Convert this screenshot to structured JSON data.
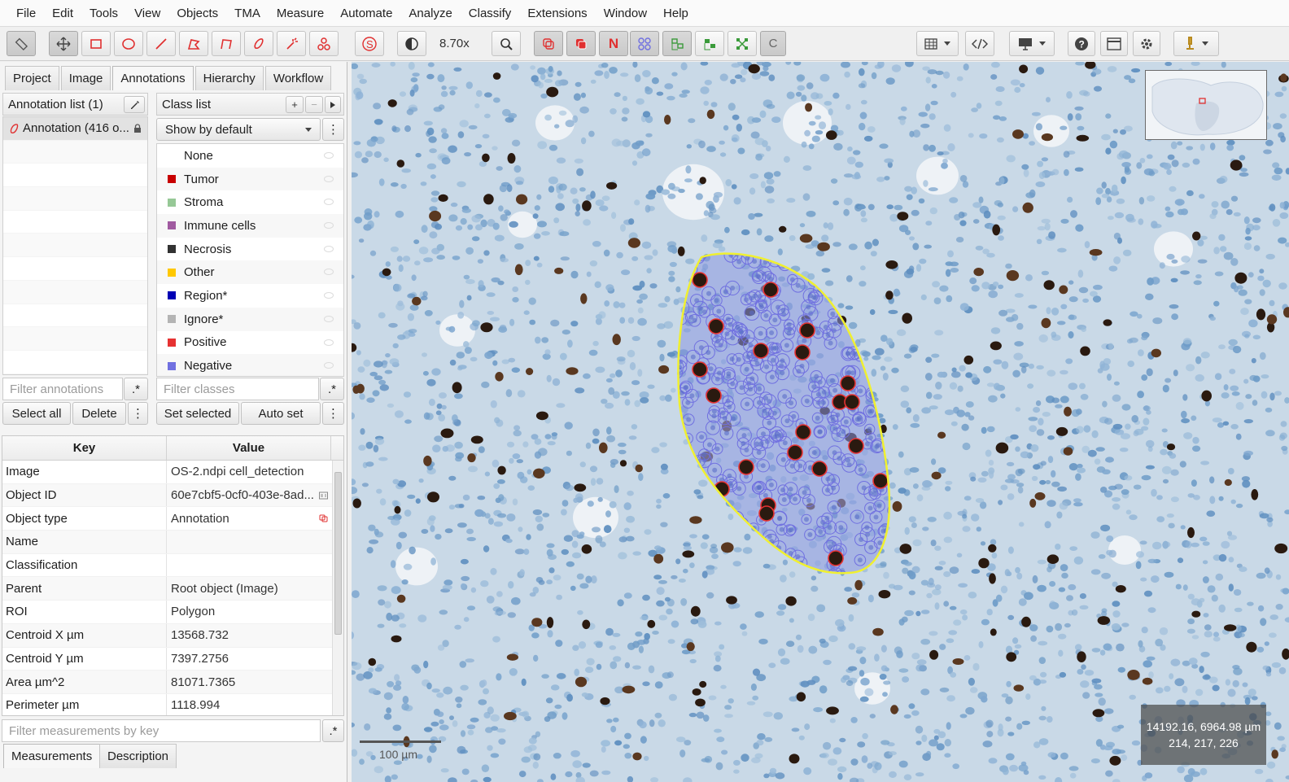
{
  "menu": [
    "File",
    "Edit",
    "Tools",
    "View",
    "Objects",
    "TMA",
    "Measure",
    "Automate",
    "Analyze",
    "Classify",
    "Extensions",
    "Window",
    "Help"
  ],
  "toolbar": {
    "zoom": "8.70x",
    "toggle_n": "N",
    "toggle_c": "C",
    "tools": [
      "move-tool",
      "rectangle-tool",
      "ellipse-tool",
      "line-tool",
      "polygon-tool",
      "polyline-tool",
      "brush-tool",
      "wand-tool",
      "points-tool",
      "selection-mode",
      "brightness-contrast",
      "zoom-to-fit",
      "show-annotations",
      "fill-annotations",
      "show-names",
      "show-tma-grid",
      "show-detections",
      "fill-detections",
      "show-pixel-classification",
      "show-connections",
      "show-convex-hull",
      "opacity-slider",
      "measurement-table",
      "script-editor",
      "display-settings",
      "help",
      "log",
      "preferences",
      "extension-tools"
    ]
  },
  "tabs": [
    "Project",
    "Image",
    "Annotations",
    "Hierarchy",
    "Workflow"
  ],
  "active_tab": "Annotations",
  "annotation_list": {
    "title": "Annotation list (1)",
    "items": [
      "Annotation (416 o..."
    ],
    "filter_placeholder": "Filter annotations",
    "regex_label": ".*",
    "select_all": "Select all",
    "delete": "Delete",
    "more": "⋮"
  },
  "class_list": {
    "title": "Class list",
    "add": "+",
    "remove": "−",
    "show_mode": "Show by default",
    "classes": [
      {
        "name": "None",
        "color": ""
      },
      {
        "name": "Tumor",
        "color": "#c80000"
      },
      {
        "name": "Stroma",
        "color": "#96c896"
      },
      {
        "name": "Immune cells",
        "color": "#a05aa0"
      },
      {
        "name": "Necrosis",
        "color": "#323232"
      },
      {
        "name": "Other",
        "color": "#ffc800"
      },
      {
        "name": "Region*",
        "color": "#0000b4"
      },
      {
        "name": "Ignore*",
        "color": "#b4b4b4"
      },
      {
        "name": "Positive",
        "color": "#e63232"
      },
      {
        "name": "Negative",
        "color": "#7070e0"
      }
    ],
    "filter_placeholder": "Filter classes",
    "regex_label": ".*",
    "set_selected": "Set selected",
    "auto_set": "Auto set",
    "more": "⋮"
  },
  "measurements": {
    "key_header": "Key",
    "value_header": "Value",
    "rows": [
      {
        "key": "Image",
        "value": "OS-2.ndpi cell_detection"
      },
      {
        "key": "Object ID",
        "value": "60e7cbf5-0cf0-403e-8ad..."
      },
      {
        "key": "Object type",
        "value": "Annotation"
      },
      {
        "key": "Name",
        "value": ""
      },
      {
        "key": "Classification",
        "value": ""
      },
      {
        "key": "Parent",
        "value": "Root object (Image)"
      },
      {
        "key": "ROI",
        "value": "Polygon"
      },
      {
        "key": "Centroid X µm",
        "value": "13568.732"
      },
      {
        "key": "Centroid Y µm",
        "value": "7397.2756"
      },
      {
        "key": "Area µm^2",
        "value": "81071.7365"
      },
      {
        "key": "Perimeter µm",
        "value": "1118.994"
      }
    ],
    "filter_placeholder": "Filter measurements by key",
    "regex_label": ".*",
    "tab_measurements": "Measurements",
    "tab_description": "Description"
  },
  "viewer": {
    "coords_line1": "14192.16, 6964.98 µm",
    "coords_line2": "214, 217, 226",
    "scale_label": "100 µm",
    "annotation_color": "#f0f030",
    "positive_color": "#e63232",
    "negative_color": "#7070e0"
  }
}
